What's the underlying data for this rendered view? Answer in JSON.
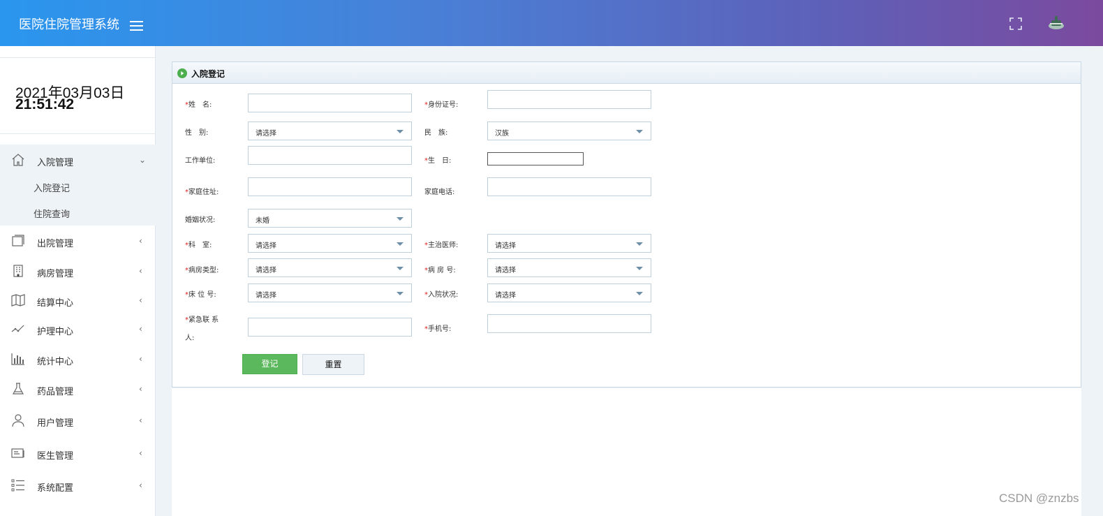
{
  "header": {
    "title": "医院住院管理系统",
    "hamburger_icon": "menu-icon",
    "fullscreen_icon": "fullscreen-icon",
    "user_icon": "user-avatar-icon"
  },
  "clock": {
    "date": "2021年03月03日",
    "time": "21:51:42"
  },
  "menu": {
    "admission": {
      "label": "入院管理",
      "icon": "home-icon",
      "arrow": "⌄"
    },
    "admission_sub": [
      "入院登记",
      "住院查询"
    ],
    "items": [
      {
        "label": "出院管理",
        "icon": "discharge-icon",
        "arrow": "‹"
      },
      {
        "label": "病房管理",
        "icon": "building-icon",
        "arrow": "‹"
      },
      {
        "label": "结算中心",
        "icon": "map-icon",
        "arrow": "‹"
      },
      {
        "label": "护理中心",
        "icon": "line-chart-icon",
        "arrow": "‹"
      },
      {
        "label": "统计中心",
        "icon": "bar-chart-icon",
        "arrow": "‹"
      },
      {
        "label": "药品管理",
        "icon": "flask-icon",
        "arrow": "‹"
      },
      {
        "label": "用户管理",
        "icon": "user-icon",
        "arrow": "‹"
      },
      {
        "label": "医生管理",
        "icon": "id-card-icon",
        "arrow": "‹"
      },
      {
        "label": "系统配置",
        "icon": "list-icon",
        "arrow": "‹"
      }
    ]
  },
  "panel": {
    "title": "入院登记",
    "icon": "play-circle-icon"
  },
  "form": {
    "req": "*",
    "name": "姓　名:",
    "id_card": "身份证号:",
    "gender": "性　别:",
    "gender_value": "请选择",
    "ethnicity": "民　族:",
    "ethnicity_value": "汉族",
    "workplace": "工作单位:",
    "birthday": "生　日:",
    "address": "家庭住址:",
    "home_phone": "家庭电话:",
    "marital": "婚姻状况:",
    "marital_value": "未婚",
    "department": "科　室:",
    "department_value": "请选择",
    "doctor": "主治医师:",
    "doctor_value": "请选择",
    "ward_type": "病房类型:",
    "ward_type_value": "请选择",
    "ward_no": "病 房 号:",
    "ward_no_value": "请选择",
    "bed_no": "床 位 号:",
    "bed_no_value": "请选择",
    "admit_status": "入院状况:",
    "admit_status_value": "请选择",
    "emergency_1": "紧急联 系",
    "emergency_2": "人:",
    "mobile": "手机号:",
    "submit": "登记",
    "reset": "重置"
  },
  "watermark": "CSDN @znzbs",
  "colors": {
    "accent_green": "#5cb85c",
    "required_red": "#e02020",
    "header_start": "#2a96ee",
    "header_end": "#7b4a9e"
  }
}
